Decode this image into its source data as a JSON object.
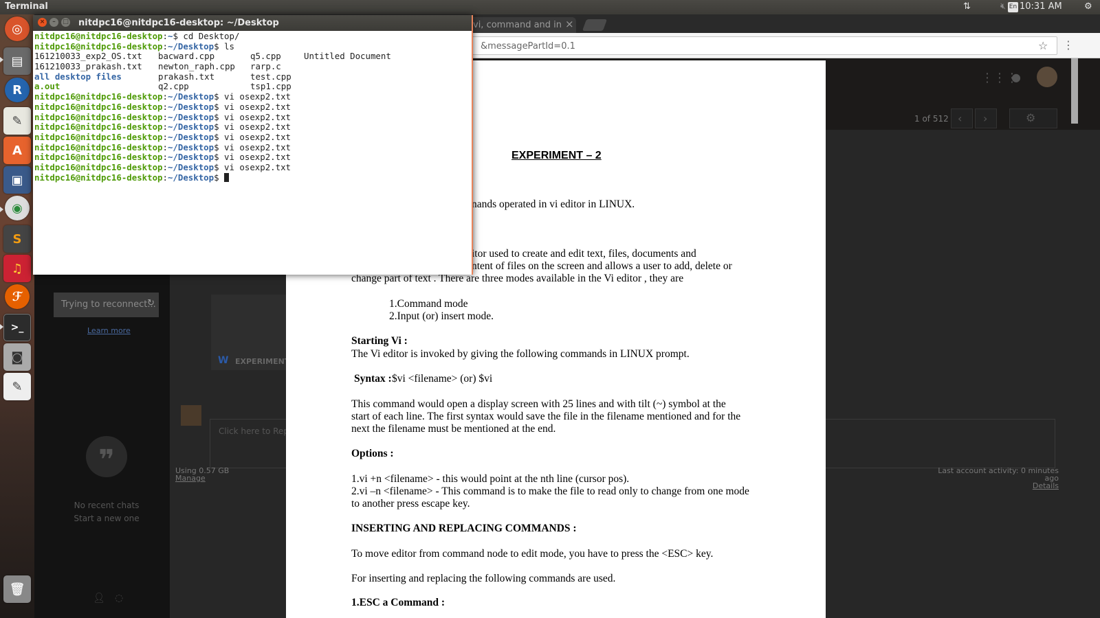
{
  "topbar": {
    "app_title": "Terminal",
    "lang": "En",
    "clock": "10:31 AM"
  },
  "launcher": {
    "items": [
      "ubuntu-dash-icon",
      "files-icon",
      "r-icon",
      "text-editor-icon",
      "software-center-icon",
      "remote-desktop-icon",
      "chrome-icon",
      "sublime-icon",
      "audio-icon",
      "firefox-icon",
      "terminal-icon",
      "camera-icon",
      "notes-icon",
      "trash-icon"
    ]
  },
  "browser": {
    "tab1": "vi, command and in",
    "tab1_close": "×",
    "address": "&messagePartId=0.1",
    "gmail": {
      "pager": "1 of 512",
      "reconnect": "Trying to reconnect...",
      "learn_more": "Learn more",
      "no_recent": "No recent chats",
      "start_new": "Start a new one",
      "attachment_label": "EXPERIMENT",
      "reply_placeholder": "Click here to Rep",
      "storage_used": "Using 0.57 GB",
      "manage": "Manage",
      "last_activity": "Last account activity: 0 minutes ago",
      "details": "Details"
    },
    "document": {
      "heading": "EXPERIMENT – 2",
      "lines": [
        "nands operated in vi editor in LINUX.",
        "itor used to create and edit text, files, documents and",
        "ntent of files on the screen and allows a user to add, delete or",
        "change part of text . There are three modes available in the Vi editor , they are",
        "1.Command mode",
        "2.Input (or) insert mode.",
        "Starting Vi :",
        " The Vi editor is invoked by giving the following commands in LINUX  prompt.",
        "Syntax :",
        " $vi <filename> (or)   $vi",
        " This command would open a display screen with 25 lines and with tilt (~) symbol at the",
        "start of each line. The first syntax would save the file in the filename mentioned and for the",
        "next the filename must be mentioned at the end.",
        "Options :",
        "1.vi +n <filename> - this would point at the nth line (cursor pos).",
        "2.vi –n <filename> - This command is to make the file to read only to change from one mode",
        "to another press escape key.",
        "INSERTING AND REPLACING COMMANDS :",
        " To move editor from command node to edit mode, you have to press the <ESC> key.",
        "For inserting and replacing the following commands are used.",
        "1.ESC a Command :"
      ]
    }
  },
  "terminal": {
    "title": "nitdpc16@nitdpc16-desktop: ~/Desktop",
    "prompt_user": "nitdpc16@nitdpc16-desktop",
    "home_path": "~",
    "desk_path": "~/Desktop",
    "cmd_cd": " cd Desktop/",
    "cmd_ls": " ls",
    "cmd_vi": " vi osexp2.txt",
    "ls_rows": [
      [
        "161210033_exp2_OS.txt",
        "bacward.cpp",
        "q5.cpp",
        "Untitled Document"
      ],
      [
        "161210033_prakash.txt",
        "newton_raph.cpp",
        "rarp.c",
        ""
      ],
      [
        "all desktop files",
        "prakash.txt",
        "test.cpp",
        ""
      ],
      [
        "a.out",
        "q2.cpp",
        "tsp1.cpp",
        ""
      ]
    ]
  }
}
